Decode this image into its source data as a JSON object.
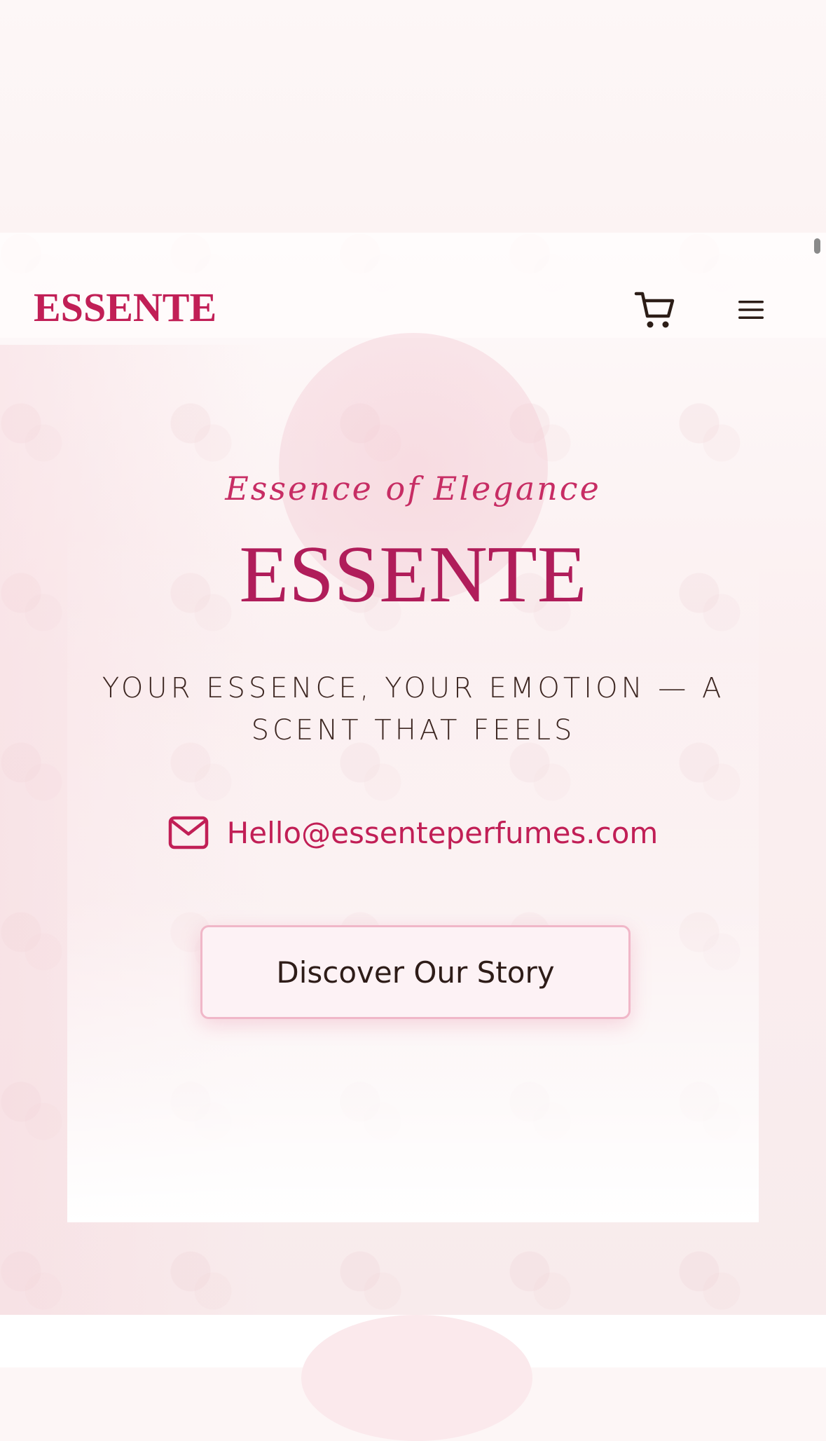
{
  "header": {
    "logo": "ESSENTE",
    "cart_icon": "cart-icon",
    "menu_icon": "hamburger-menu-icon"
  },
  "hero": {
    "tagline": "Essence of Elegance",
    "title": "ESSENTE",
    "subtitle": "YOUR ESSENCE, YOUR EMOTION — A SCENT THAT FEELS",
    "email_icon": "mail-icon",
    "email": "Hello@essenteperfumes.com",
    "cta_label": "Discover Our Story"
  },
  "colors": {
    "brand": "#c11f56",
    "brand_dark": "#b01d5a",
    "text_dark": "#3d2722",
    "cta_border": "#f0b7c8"
  }
}
